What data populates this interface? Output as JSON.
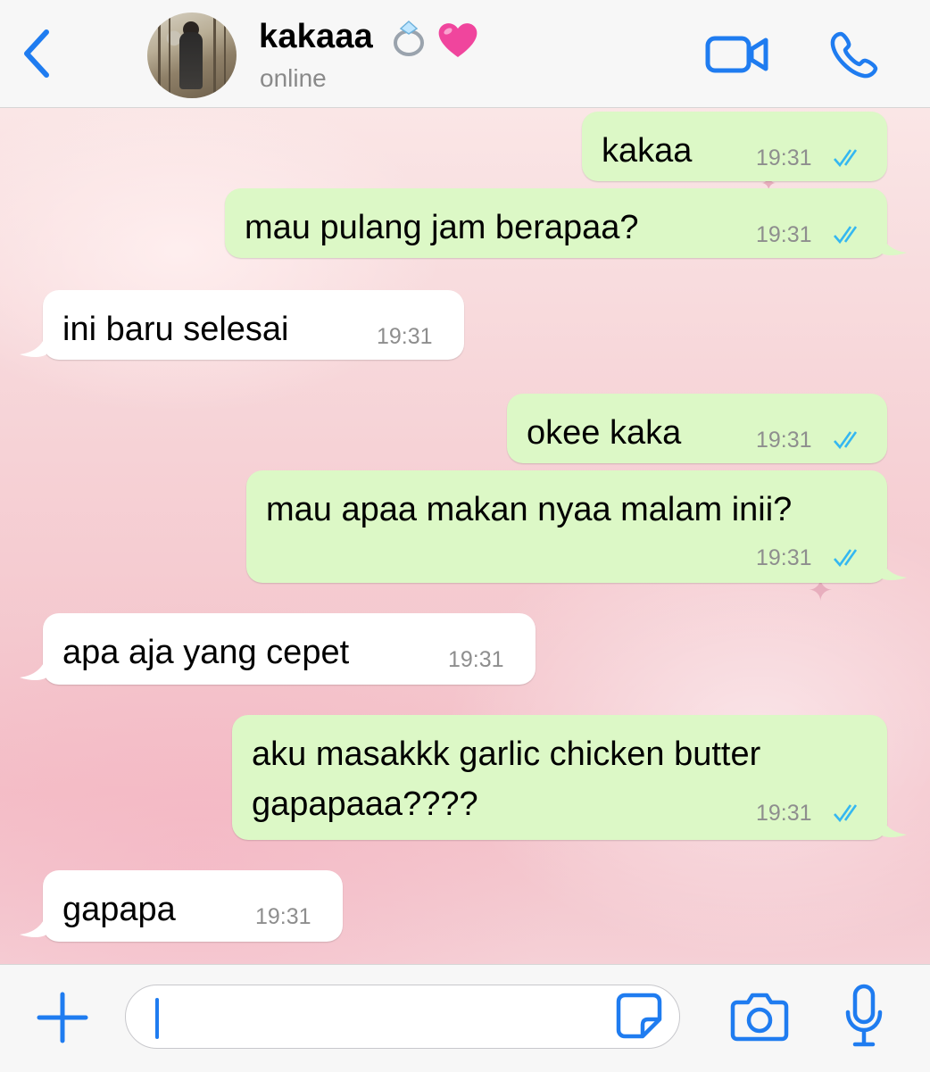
{
  "header": {
    "contact_name": "kakaaa",
    "status": "online",
    "back_icon": "chevron-left-icon",
    "video_icon": "video-camera-icon",
    "call_icon": "phone-icon",
    "accent_color": "#1f7cf0"
  },
  "messages": [
    {
      "direction": "outgoing",
      "text": "kakaa",
      "time": "19:31",
      "read": true
    },
    {
      "direction": "outgoing",
      "text": "mau pulang jam berapaa?",
      "time": "19:31",
      "read": true
    },
    {
      "direction": "incoming",
      "text": "ini baru selesai",
      "time": "19:31"
    },
    {
      "direction": "outgoing",
      "text": "okee kaka",
      "time": "19:31",
      "read": true
    },
    {
      "direction": "outgoing",
      "text": "mau apaa makan nyaa malam inii?",
      "time": "19:31",
      "read": true
    },
    {
      "direction": "incoming",
      "text": "apa aja yang cepet",
      "time": "19:31"
    },
    {
      "direction": "outgoing",
      "text_line1": "aku masakkk garlic chicken butter",
      "text_line2": "gapapaaa????",
      "time": "19:31",
      "read": true
    },
    {
      "direction": "incoming",
      "text": "gapapa",
      "time": "19:31"
    }
  ],
  "input_bar": {
    "value": "",
    "icons": [
      "plus-icon",
      "sticker-icon",
      "camera-icon",
      "microphone-icon"
    ]
  },
  "colors": {
    "outgoing_bubble": "#dcf8c6",
    "incoming_bubble": "#ffffff",
    "read_ticks": "#34b7f1"
  }
}
